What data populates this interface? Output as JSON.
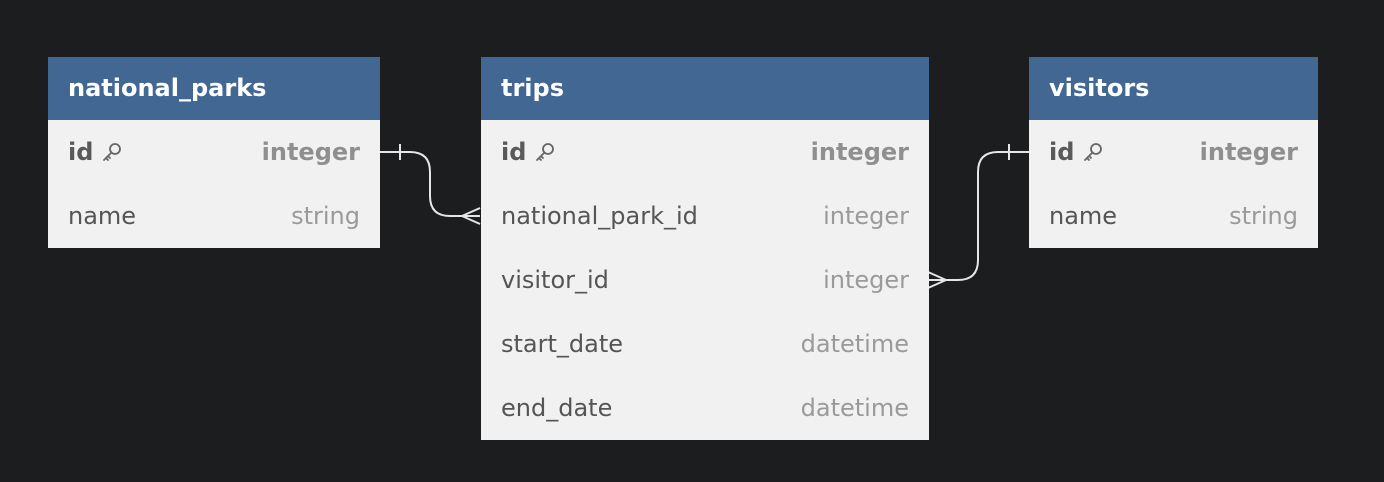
{
  "tables": {
    "national_parks": {
      "name": "national_parks",
      "columns": [
        {
          "name": "id",
          "type": "integer",
          "primary_key": true
        },
        {
          "name": "name",
          "type": "string",
          "primary_key": false
        }
      ]
    },
    "trips": {
      "name": "trips",
      "columns": [
        {
          "name": "id",
          "type": "integer",
          "primary_key": true
        },
        {
          "name": "national_park_id",
          "type": "integer",
          "primary_key": false
        },
        {
          "name": "visitor_id",
          "type": "integer",
          "primary_key": false
        },
        {
          "name": "start_date",
          "type": "datetime",
          "primary_key": false
        },
        {
          "name": "end_date",
          "type": "datetime",
          "primary_key": false
        }
      ]
    },
    "visitors": {
      "name": "visitors",
      "columns": [
        {
          "name": "id",
          "type": "integer",
          "primary_key": true
        },
        {
          "name": "name",
          "type": "string",
          "primary_key": false
        }
      ]
    }
  },
  "relationships": [
    {
      "from": "national_parks.id",
      "to": "trips.national_park_id",
      "cardinality": "one-to-many"
    },
    {
      "from": "visitors.id",
      "to": "trips.visitor_id",
      "cardinality": "one-to-many"
    }
  ],
  "colors": {
    "background": "#1c1d1f",
    "header": "#426792",
    "body": "#f1f1f1",
    "connector": "#e6e6e6"
  },
  "icons": {
    "primary_key": "key-icon"
  }
}
